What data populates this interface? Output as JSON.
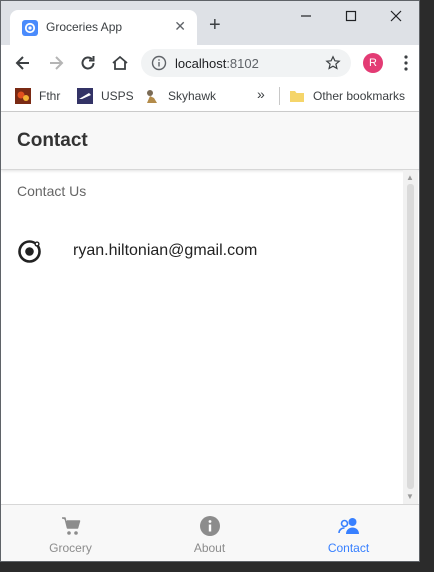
{
  "browser": {
    "tab_title": "Groceries App",
    "url_host": "localhost",
    "url_port": ":8102",
    "avatar_letter": "R",
    "bookmarks": [
      {
        "label": "Fthr",
        "icon": "fthr-icon"
      },
      {
        "label": "USPS",
        "icon": "usps-icon"
      },
      {
        "label": "Skyhawk",
        "icon": "skyhawk-icon"
      }
    ],
    "overflow_label": "»",
    "other_bookmarks": "Other bookmarks"
  },
  "header": {
    "title": "Contact"
  },
  "content": {
    "section_title": "Contact Us",
    "contact": {
      "icon": "ionic-icon",
      "email": "ryan.hiltonian@gmail.com"
    }
  },
  "tabs": [
    {
      "label": "Grocery",
      "icon": "cart-icon",
      "active": false
    },
    {
      "label": "About",
      "icon": "info-icon",
      "active": false
    },
    {
      "label": "Contact",
      "icon": "people-icon",
      "active": true
    }
  ],
  "colors": {
    "accent": "#3880ff",
    "inactive": "#8c8c8c",
    "avatar": "#e33b74"
  }
}
